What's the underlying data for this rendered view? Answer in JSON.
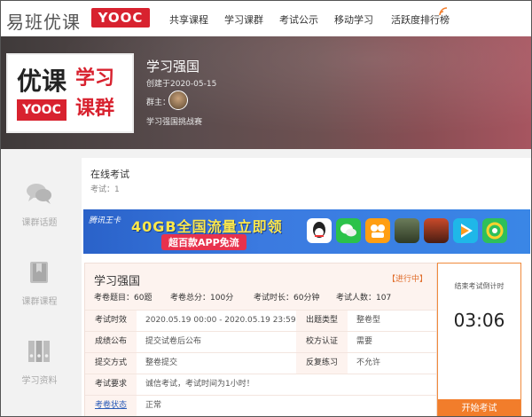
{
  "header": {
    "logo_text": "易班优课",
    "logo_badge": "YOOC",
    "nav": [
      "共享课程",
      "学习课群",
      "考试公示",
      "移动学习",
      "活跃度排行榜"
    ]
  },
  "group": {
    "logo": {
      "line1": "优课",
      "badge": "YOOC",
      "line2": "学习",
      "line3": "课群"
    },
    "name": "学习强国",
    "created": "创建于2020-05-15",
    "owner_label": "群主：",
    "tag": "学习强国挑战赛"
  },
  "sidebar": [
    {
      "label": "课群话题",
      "icon": "chat-bubbles-icon"
    },
    {
      "label": "课群课程",
      "icon": "book-icon"
    },
    {
      "label": "学习资料",
      "icon": "binders-icon"
    }
  ],
  "section": {
    "title": "在线考试",
    "subtitle": "考试：1"
  },
  "ad": {
    "brand": "腾讯王卡",
    "line1": "40GB全国流量立即领",
    "line2": "超百款APP免流"
  },
  "exam": {
    "name": "学习强国",
    "status": "【进行中】",
    "stats": [
      {
        "label": "考卷题目：",
        "value": "60题"
      },
      {
        "label": "考卷总分：",
        "value": "100分"
      },
      {
        "label": "考试时长：",
        "value": "60分钟"
      },
      {
        "label": "考试人数：",
        "value": "107"
      }
    ],
    "rows": [
      [
        {
          "label": "考试时效",
          "value": "2020.05.19 00:00 - 2020.05.19 23:59"
        },
        {
          "label": "出题类型",
          "value": "整卷型"
        }
      ],
      [
        {
          "label": "成绩公布",
          "value": "提交试卷后公布"
        },
        {
          "label": "校方认证",
          "value": "需要"
        }
      ],
      [
        {
          "label": "提交方式",
          "value": "整卷提交"
        },
        {
          "label": "反复练习",
          "value": "不允许"
        }
      ],
      [
        {
          "label": "考试要求",
          "value": "诚信考试，考试时间为1小时！"
        }
      ],
      [
        {
          "label": "考卷状态",
          "value": "正常"
        }
      ]
    ]
  },
  "timer": {
    "label": "结束考试倒计时",
    "value": "03:06",
    "button": "开始考试"
  },
  "colors": {
    "brand_red": "#d8222f",
    "accent_orange": "#f27d2b",
    "status_orange": "#e06c2a"
  }
}
